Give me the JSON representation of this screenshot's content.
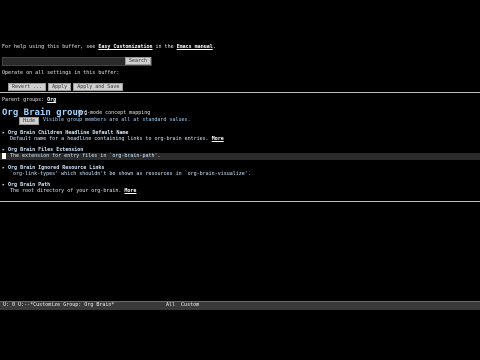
{
  "help": {
    "prefix": "For help using this buffer, see ",
    "link1": "Easy Customization",
    "mid": " in the ",
    "link2": "Emacs manual",
    "suffix": "."
  },
  "search": {
    "button_label": "Search"
  },
  "operate": {
    "text": "Operate on all settings in this buffer:",
    "buttons": [
      "Revert ...",
      "Apply",
      "Apply and Save"
    ]
  },
  "parent": {
    "label": "Parent groups: ",
    "link": "Org"
  },
  "group": {
    "title": "Org Brain group:",
    "doc": "Org-mode concept mapping",
    "hide_label": "Hide",
    "visible_note": "Visible group members are all at standard values."
  },
  "entries": [
    {
      "marker": "▸",
      "title": "Org Brain Children Headline Default Name",
      "doc": "Default name for a headline containing links to org-brain entries.",
      "more": "More"
    },
    {
      "marker": "▸",
      "title": "Org Brain Files Extension",
      "doc": "The extension for entry files in `org-brain-path'."
    },
    {
      "marker": "▸",
      "title": "Org Brain Ignored Resource Links",
      "doc": "`org-link-types' which shouldn't be shown as resources in `org-brain-visualize'."
    },
    {
      "marker": "▸",
      "title": "Org Brain Path",
      "doc": "The root directory of your org-brain.",
      "more": "More"
    }
  ],
  "modeline": {
    "left": "U: 0 U:--*Customize Group: Org Brain*",
    "right": "All  Custom"
  }
}
